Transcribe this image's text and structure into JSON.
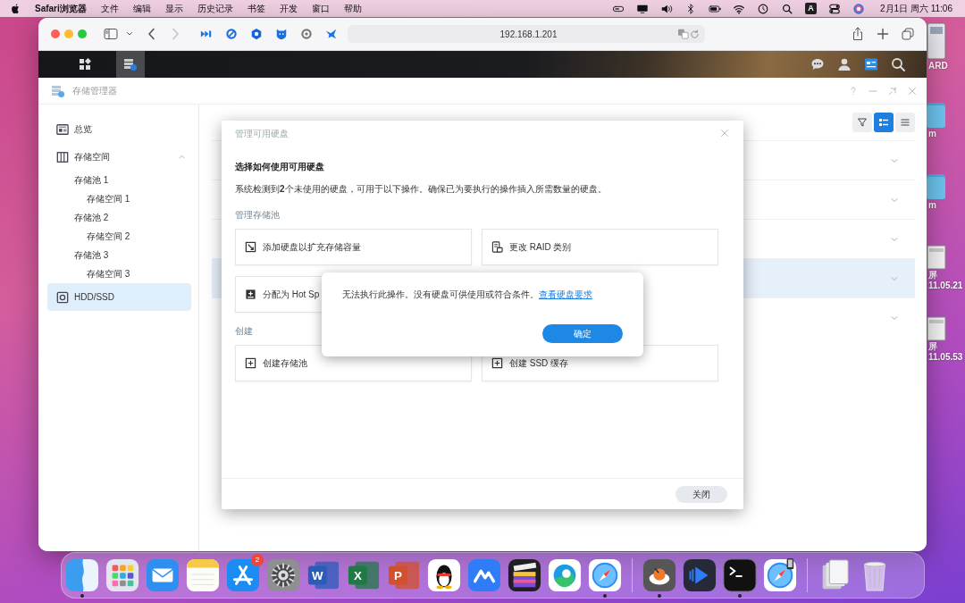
{
  "menu_bar": {
    "app_name": "Safari浏览器",
    "menus": [
      "文件",
      "编辑",
      "显示",
      "历史记录",
      "书签",
      "开发",
      "窗口",
      "帮助"
    ],
    "input_source": "A",
    "clock": "2月1日 周六 11:06"
  },
  "browser": {
    "forward_disabled": true,
    "url": "192.168.1.201"
  },
  "dsm_taskbar": {
    "apps": [
      {
        "kind": "main-menu",
        "selected": false
      },
      {
        "kind": "storage",
        "selected": true
      }
    ]
  },
  "window": {
    "title": "存储管理器"
  },
  "sidebar": {
    "items": [
      {
        "label": "总览",
        "kind": "overview",
        "selected": false
      },
      {
        "label": "存储空间",
        "kind": "volume",
        "selected": false,
        "expanded": true,
        "children": [
          {
            "label": "存储池 1",
            "selected": false,
            "children": [
              {
                "label": "存储空间 1",
                "selected": false
              }
            ]
          },
          {
            "label": "存储池 2",
            "selected": false,
            "children": [
              {
                "label": "存储空间 2",
                "selected": false
              }
            ]
          },
          {
            "label": "存储池 3",
            "selected": false,
            "children": [
              {
                "label": "存储空间 3",
                "selected": false
              }
            ]
          }
        ]
      },
      {
        "label": "HDD/SSD",
        "kind": "disk",
        "selected": true
      }
    ]
  },
  "view_buttons": [
    {
      "kind": "filter",
      "selected": false
    },
    {
      "kind": "cards",
      "selected": true
    },
    {
      "kind": "list",
      "selected": false
    }
  ],
  "rows": [
    {
      "selected": false
    },
    {
      "selected": false
    },
    {
      "selected": false
    },
    {
      "selected": true
    },
    {
      "selected": false
    }
  ],
  "dialog": {
    "title": "管理可用硬盘",
    "heading": "选择如何使用可用硬盘",
    "description": "系统检测到**2**个未使用的硬盘，可用于以下操作。确保已为要执行的操作插入所需数量的硬盘。",
    "sections": [
      {
        "title": "管理存储池",
        "actions": [
          {
            "label": "添加硬盘以扩充存储容量",
            "kind": "expand"
          },
          {
            "label": "更改 RAID 类别",
            "kind": "raid"
          },
          {
            "label": "分配为 Hot Sp",
            "kind": "spare"
          }
        ]
      },
      {
        "title": "创建",
        "actions": [
          {
            "label": "创建存储池",
            "kind": "plus"
          },
          {
            "label": "创建 SSD 缓存",
            "kind": "plus"
          }
        ]
      }
    ],
    "close_button": "关闭"
  },
  "alert": {
    "message": "无法执行此操作。没有硬盘可供使用或符合条件。",
    "link": "查看硬盘要求",
    "button": "确定"
  },
  "desktop_icons": [
    {
      "kind": "thumbnail",
      "label": "ARD"
    },
    {
      "kind": "folder",
      "label": "m"
    },
    {
      "kind": "folder",
      "label": "m"
    },
    {
      "kind": "screenshot",
      "label": "屏",
      "sublabel": "11.05.21"
    },
    {
      "kind": "screenshot",
      "label": "屏",
      "sublabel": "11.05.53"
    }
  ],
  "dock": {
    "apps": [
      {
        "kind": "split-square",
        "running": true
      },
      {
        "kind": "app-grid",
        "running": false
      },
      {
        "kind": "envelope",
        "running": false
      },
      {
        "kind": "notepad",
        "running": false
      },
      {
        "kind": "sticks",
        "running": false,
        "badge": "2"
      },
      {
        "kind": "gear",
        "running": false
      },
      {
        "kind": "document",
        "color": "#2b5cb8",
        "glyph": "W",
        "running": false
      },
      {
        "kind": "document",
        "color": "#1f7a45",
        "glyph": "X",
        "running": false
      },
      {
        "kind": "document",
        "color": "#d2502b",
        "glyph": "P",
        "running": false
      },
      {
        "kind": "penguin",
        "running": false
      },
      {
        "kind": "wave",
        "running": false
      },
      {
        "kind": "clapperboard",
        "running": false
      },
      {
        "kind": "swirl",
        "running": false
      },
      {
        "kind": "compass",
        "running": true
      },
      {
        "kind": "separator"
      },
      {
        "kind": "bowl",
        "running": true
      },
      {
        "kind": "play",
        "running": false
      },
      {
        "kind": "terminal",
        "running": true
      },
      {
        "kind": "compass-phone",
        "running": false
      },
      {
        "kind": "separator"
      },
      {
        "kind": "stack",
        "running": false
      },
      {
        "kind": "trash",
        "running": false
      }
    ]
  }
}
